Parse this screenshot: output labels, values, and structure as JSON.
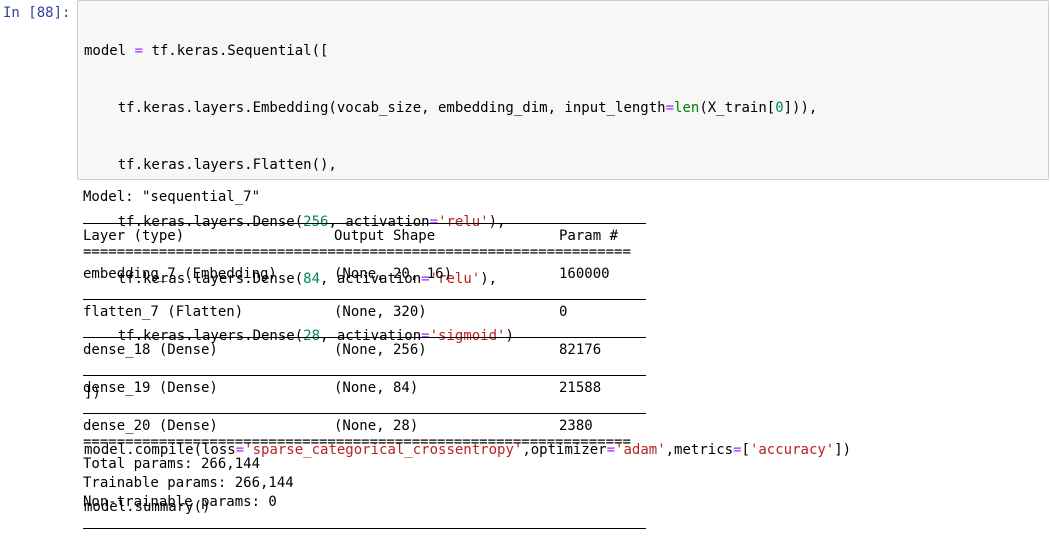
{
  "cell": {
    "prompt": "In [88]:",
    "code_lines": [
      "model = tf.keras.Sequential([",
      "    tf.keras.layers.Embedding(vocab_size, embedding_dim, input_length=len(X_train[0])),",
      "    tf.keras.layers.Flatten(),",
      "    tf.keras.layers.Dense(256, activation='relu'),",
      "    tf.keras.layers.Dense(84, activation='relu'),",
      "    tf.keras.layers.Dense(28, activation='sigmoid')",
      "])",
      "model.compile(loss='sparse_categorical_crossentropy',optimizer='adam',metrics=['accuracy'])",
      "model.summary()"
    ]
  },
  "output": {
    "model_label": "Model: \"sequential_7\"",
    "headers": {
      "layer": "Layer (type)",
      "output_shape": "Output Shape",
      "params": "Param #"
    },
    "rows": [
      {
        "layer": "embedding_7 (Embedding)",
        "output_shape": "(None, 20, 16)",
        "params": "160000"
      },
      {
        "layer": "flatten_7 (Flatten)",
        "output_shape": "(None, 320)",
        "params": "0"
      },
      {
        "layer": "dense_18 (Dense)",
        "output_shape": "(None, 256)",
        "params": "82176"
      },
      {
        "layer": "dense_19 (Dense)",
        "output_shape": "(None, 84)",
        "params": "21588"
      },
      {
        "layer": "dense_20 (Dense)",
        "output_shape": "(None, 28)",
        "params": "2380"
      }
    ],
    "total_params": "Total params: 266,144",
    "trainable_params": "Trainable params: 266,144",
    "non_trainable_params": "Non-trainable params: 0"
  },
  "colors": {
    "prompt": "#303f9f",
    "input_bg": "#f7f7f7",
    "input_border": "#cfcfcf",
    "string": "#ba2121",
    "number": "#098658",
    "operator": "#aa22ff"
  }
}
